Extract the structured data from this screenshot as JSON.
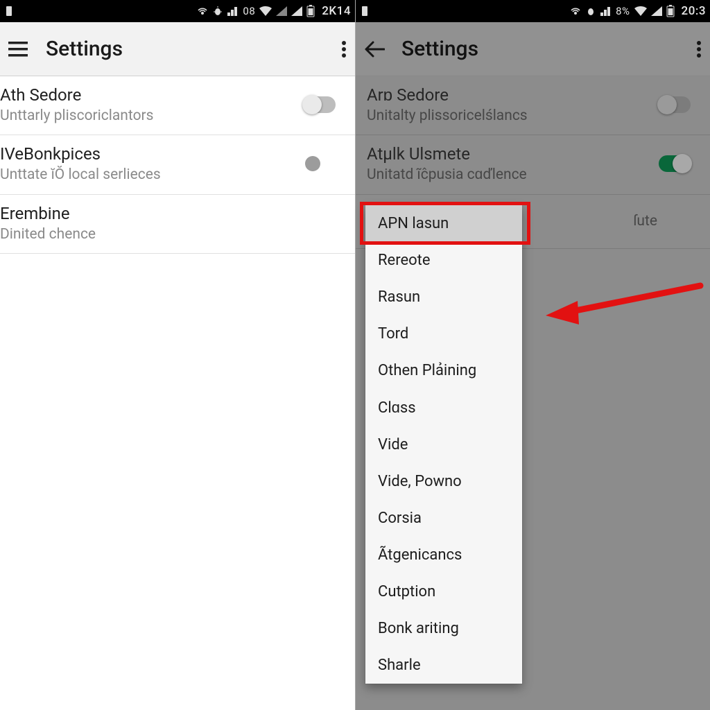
{
  "left": {
    "status": {
      "signal_pct": "08",
      "time": "2K14"
    },
    "appbar": {
      "title": "Settings"
    },
    "rows": [
      {
        "primary": "Ath Sedore",
        "secondary": "Unttarly pliscoriclantors",
        "control": "switch-off"
      },
      {
        "primary": "IVeBonkpices",
        "secondary": "Unttate ĭŎ local serlieces",
        "control": "dot"
      },
      {
        "primary": "Erembine",
        "secondary": "Dinited chence",
        "control": "none"
      }
    ]
  },
  "right": {
    "status": {
      "signal_pct": "8%",
      "time": "20:3"
    },
    "appbar": {
      "title": "Settings"
    },
    "rows": [
      {
        "primary": "Arɒ Sedore",
        "secondary": "Unitalty plissoricelślancs",
        "control": "switch-off"
      },
      {
        "primary": "Atµlk Ulsmete",
        "secondary": "Unitatd ĩĉpusia cɑďlence",
        "control": "switch-on"
      },
      {
        "primary": "",
        "secondary": "ſute",
        "control": "none"
      }
    ],
    "popup_items": [
      "APN lasun",
      "Rereote",
      "Rasun",
      "Tord",
      "Othen Plảining",
      "Clɑss",
      "Vide",
      "Vide, Powno",
      "Corsia",
      "Ãtgenicancs",
      "Cutption",
      "Bonk ariting",
      "Sharle"
    ],
    "popup_selected_index": 0
  },
  "colors": {
    "accent_green": "#0f9d58",
    "annotation_red": "#e21111"
  }
}
